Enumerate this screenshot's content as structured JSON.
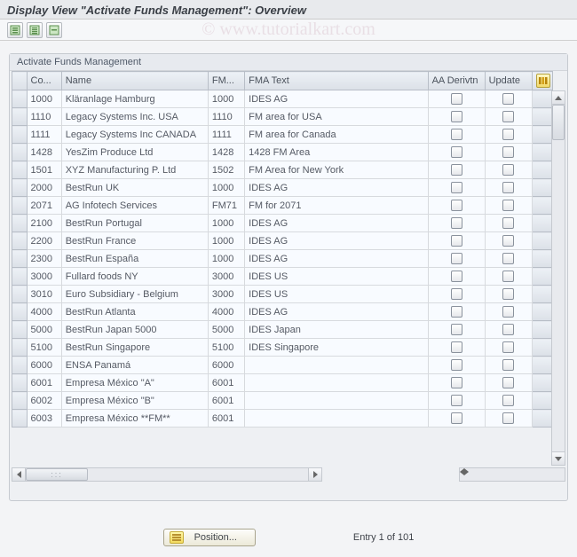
{
  "title": "Display View \"Activate Funds Management\": Overview",
  "watermark": "© www.tutorialkart.com",
  "panel_title": "Activate Funds Management",
  "columns": {
    "code": "Co...",
    "name": "Name",
    "fm": "FM...",
    "fmatext": "FMA Text",
    "aa": "AA Derivtn",
    "update": "Update"
  },
  "rows": [
    {
      "code": "1000",
      "name": "Kläranlage Hamburg",
      "fm": "1000",
      "fmatext": "IDES AG"
    },
    {
      "code": "1110",
      "name": "Legacy Systems Inc. USA",
      "fm": "1110",
      "fmatext": "FM area for USA"
    },
    {
      "code": "1111",
      "name": "Legacy Systems Inc CANADA",
      "fm": "1111",
      "fmatext": "FM area for Canada"
    },
    {
      "code": "1428",
      "name": "YesZim Produce Ltd",
      "fm": "1428",
      "fmatext": "1428 FM Area"
    },
    {
      "code": "1501",
      "name": "XYZ Manufacturing P. Ltd",
      "fm": "1502",
      "fmatext": "FM Area for New York"
    },
    {
      "code": "2000",
      "name": "BestRun UK",
      "fm": "1000",
      "fmatext": "IDES AG"
    },
    {
      "code": "2071",
      "name": "AG Infotech Services",
      "fm": "FM71",
      "fmatext": "FM for 2071"
    },
    {
      "code": "2100",
      "name": "BestRun Portugal",
      "fm": "1000",
      "fmatext": "IDES AG"
    },
    {
      "code": "2200",
      "name": "BestRun France",
      "fm": "1000",
      "fmatext": "IDES AG"
    },
    {
      "code": "2300",
      "name": "BestRun España",
      "fm": "1000",
      "fmatext": "IDES AG"
    },
    {
      "code": "3000",
      "name": "Fullard foods NY",
      "fm": "3000",
      "fmatext": "IDES US"
    },
    {
      "code": "3010",
      "name": "Euro Subsidiary - Belgium",
      "fm": "3000",
      "fmatext": "IDES US"
    },
    {
      "code": "4000",
      "name": "BestRun Atlanta",
      "fm": "4000",
      "fmatext": "IDES AG"
    },
    {
      "code": "5000",
      "name": "BestRun Japan 5000",
      "fm": "5000",
      "fmatext": "IDES Japan"
    },
    {
      "code": "5100",
      "name": "BestRun Singapore",
      "fm": "5100",
      "fmatext": "IDES Singapore"
    },
    {
      "code": "6000",
      "name": "ENSA  Panamá",
      "fm": "6000",
      "fmatext": ""
    },
    {
      "code": "6001",
      "name": "Empresa México \"A\"",
      "fm": "6001",
      "fmatext": ""
    },
    {
      "code": "6002",
      "name": "Empresa México \"B\"",
      "fm": "6001",
      "fmatext": ""
    },
    {
      "code": "6003",
      "name": "Empresa México **FM**",
      "fm": "6001",
      "fmatext": ""
    }
  ],
  "footer": {
    "position_label": "Position...",
    "entry_text": "Entry 1 of 101"
  }
}
